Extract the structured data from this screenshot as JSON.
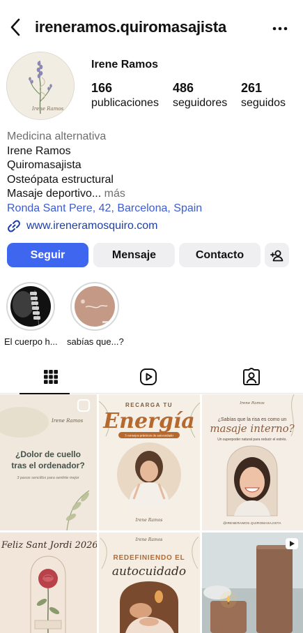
{
  "header": {
    "username": "ireneramos.quiromasajista"
  },
  "profile": {
    "display_name": "Irene Ramos",
    "avatar_caption": "Irene Ramos",
    "stats": [
      {
        "value": "166",
        "label": "publicaciones"
      },
      {
        "value": "486",
        "label": "seguidores"
      },
      {
        "value": "261",
        "label": "seguidos"
      }
    ],
    "bio": {
      "category": "Medicina alternativa",
      "lines": [
        "Irene Ramos",
        "Quiromasajista",
        "Osteópata estructural"
      ],
      "truncated_line": "Masaje deportivo...",
      "more": "más",
      "location": "Ronda Sant Pere, 42, Barcelona, Spain"
    },
    "website": "www.ireneramosquiro.com"
  },
  "actions": {
    "follow": "Seguir",
    "message": "Mensaje",
    "contact": "Contacto"
  },
  "highlights": [
    {
      "label": "El cuerpo h..."
    },
    {
      "label": "sabías que...?"
    }
  ],
  "posts": {
    "p1": {
      "brand": "Irene Ramos",
      "headline": "¿Dolor de cuello tras el ordenador?",
      "sub": "3 pasos sencillos para sentirte mejor"
    },
    "p2": {
      "kicker": "RECARGA TU",
      "title": "Energía",
      "tag": "3 consejos prácticos de autocuidado",
      "footer": "Irene Ramos"
    },
    "p3": {
      "brand": "Irene Ramos",
      "q1": "¿Sabías que la risa es como un",
      "q2": "masaje interno?",
      "sub": "Un superpoder natural para reducir el estrés.",
      "handle": "@IRENERAMOS.QUIROMASAJISTA"
    },
    "p4": {
      "title": "Feliz Sant Jordi 2026"
    },
    "p5": {
      "brand": "Irene Ramos",
      "kicker": "REDEFINIENDO EL",
      "title": "autocuidado"
    }
  },
  "colors": {
    "accent": "#3e66ee",
    "link": "#1d3fa6",
    "energy": "#b5692f"
  }
}
